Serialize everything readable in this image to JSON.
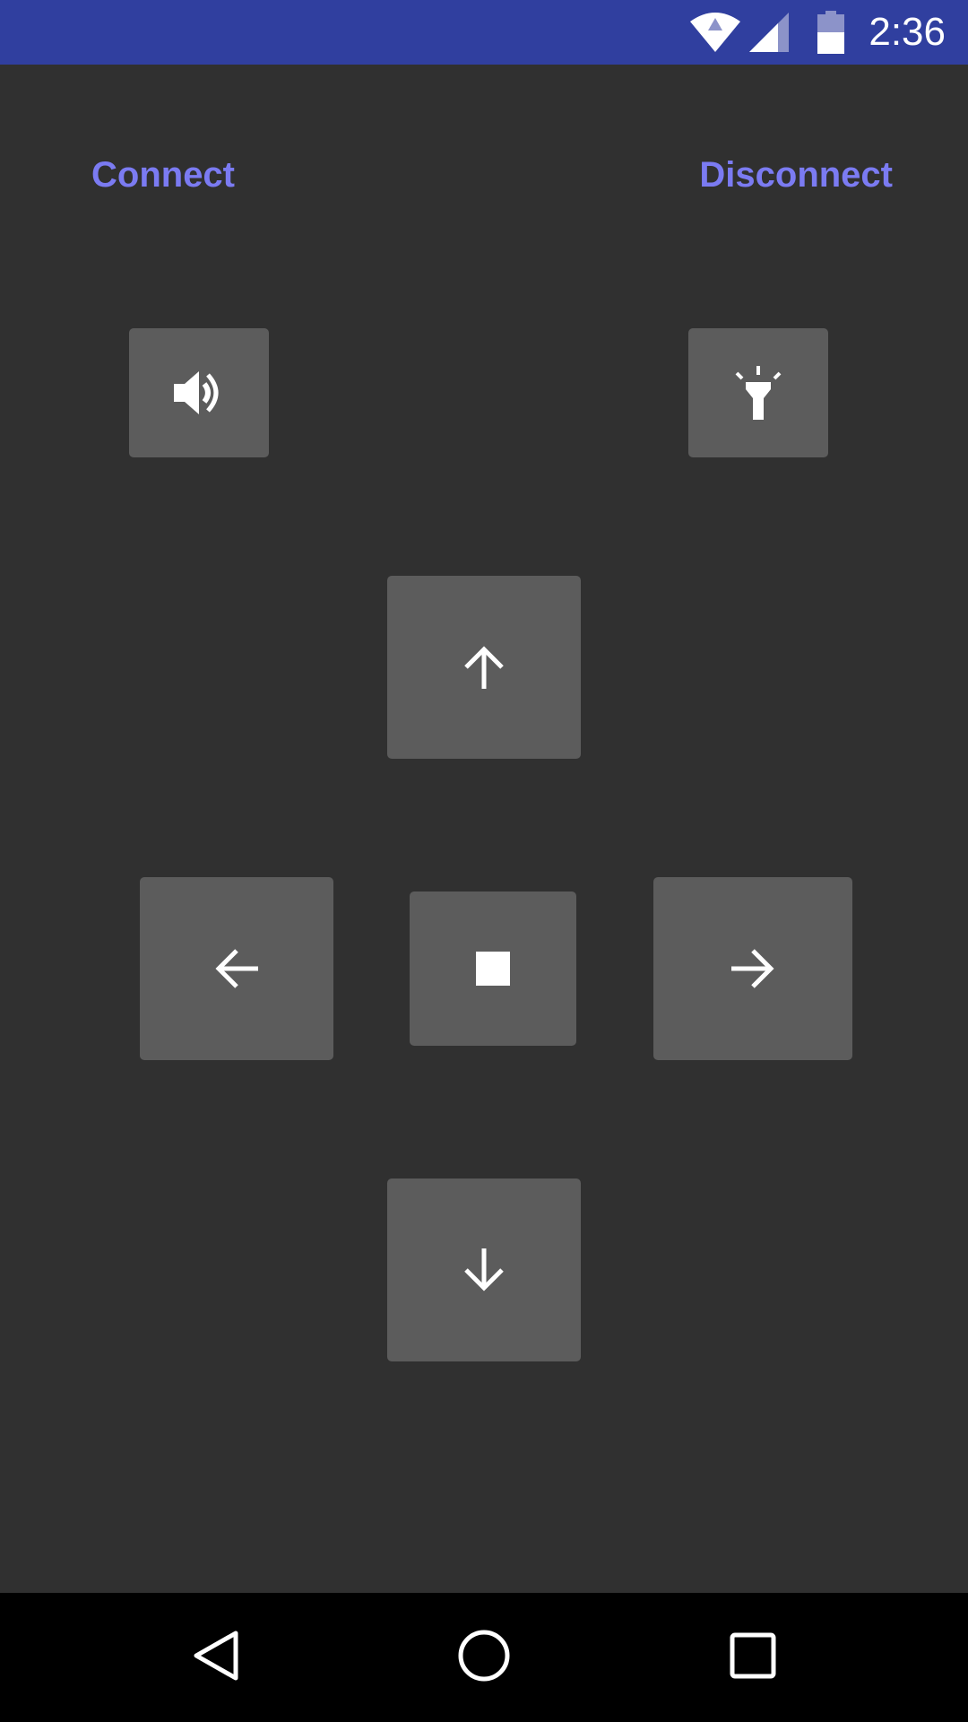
{
  "status_bar": {
    "time": "2:36",
    "color": "#303F9F",
    "icons": [
      "wifi-icon",
      "cell-signal-icon",
      "battery-icon"
    ]
  },
  "actions": {
    "connect_label": "Connect",
    "disconnect_label": "Disconnect",
    "accent_color": "#7B7BF2"
  },
  "controls": {
    "horn_icon": "volume-icon",
    "light_icon": "flashlight-icon",
    "up_icon": "arrow-up-icon",
    "left_icon": "arrow-left-icon",
    "stop_icon": "stop-icon",
    "right_icon": "arrow-right-icon",
    "down_icon": "arrow-down-icon",
    "button_color": "#5C5C5C"
  },
  "nav_bar": {
    "icons": [
      "back-icon",
      "home-icon",
      "recent-apps-icon"
    ]
  }
}
